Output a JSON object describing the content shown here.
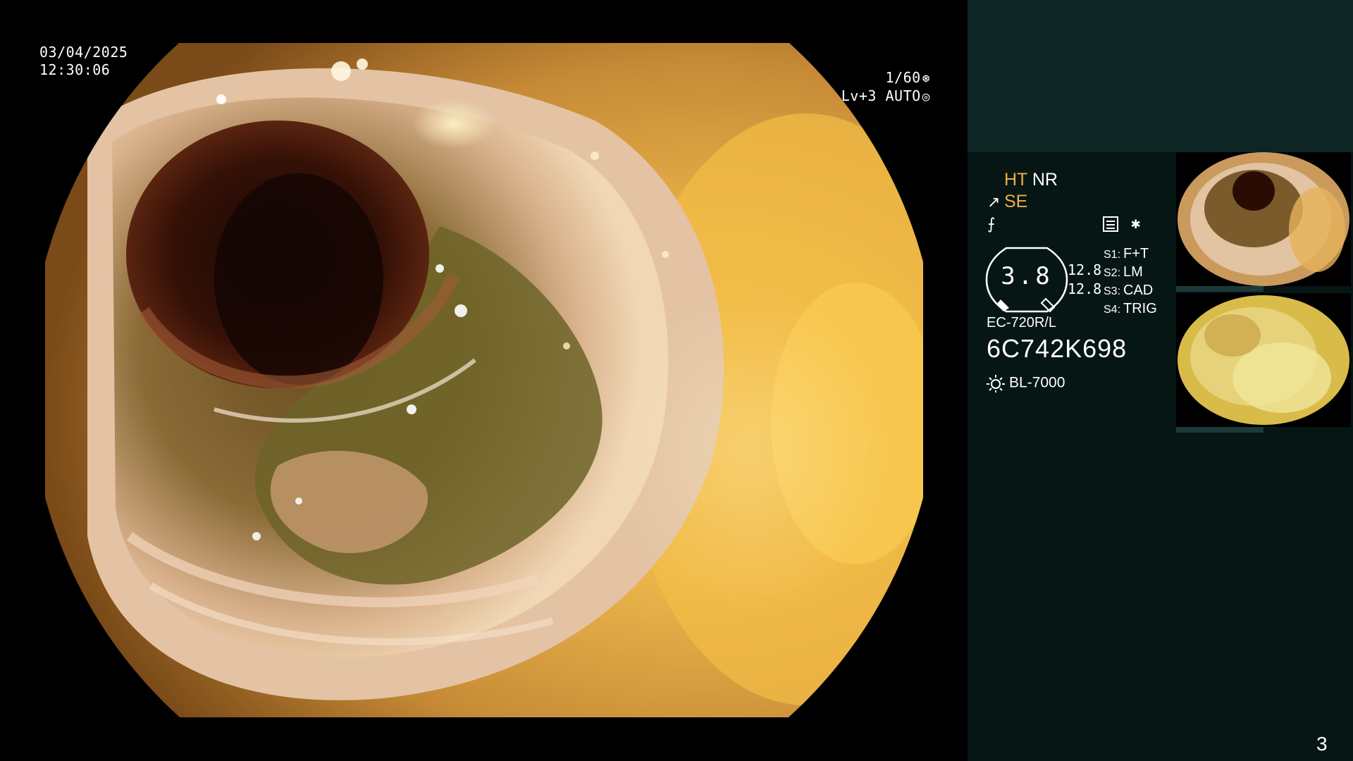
{
  "osd": {
    "date": "03/04/2025",
    "time": "12:30:06",
    "shutter": "1/60",
    "level": "Lv+3",
    "mode": "AUTO"
  },
  "settings": {
    "ht": "HT",
    "nr": "NR",
    "se": "SE"
  },
  "gauge": {
    "value": "3.8",
    "side_top": "12.8",
    "side_bottom": "12.8"
  },
  "switches": [
    {
      "label": "S1:",
      "value": "F+T"
    },
    {
      "label": "S2:",
      "value": "LM"
    },
    {
      "label": "S3:",
      "value": "CAD"
    },
    {
      "label": "S4:",
      "value": "TRIG"
    }
  ],
  "scope": {
    "model": "EC-720R/L",
    "serial": "6C742K698",
    "light_source": "BL-7000"
  },
  "page_number": "3",
  "colors": {
    "panel_bg": "#061614",
    "panel_top": "#0d2523",
    "accent_orange": "#f0ae48"
  },
  "icons": [
    "shutter-icon",
    "auto-iris-icon",
    "scope-tip-icon",
    "freeze-icon",
    "menu-icon",
    "asterisk-icon",
    "light-source-icon"
  ]
}
